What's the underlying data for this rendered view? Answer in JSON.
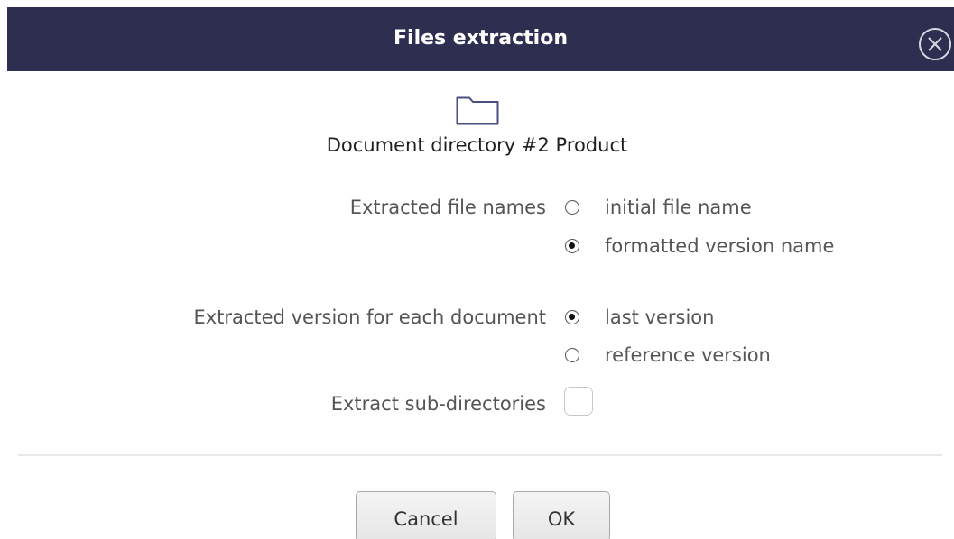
{
  "dialog": {
    "title": "Files extraction",
    "close_icon": "circle-x-icon",
    "folder_icon": "folder-icon",
    "directory_label": "Document directory #2 Product"
  },
  "file_names": {
    "label": "Extracted file names",
    "options": [
      {
        "label": "initial file name",
        "checked": false
      },
      {
        "label": "formatted version name",
        "checked": true
      }
    ]
  },
  "version": {
    "label": "Extracted version for each document",
    "options": [
      {
        "label": "last version",
        "checked": true
      },
      {
        "label": "reference version",
        "checked": false
      }
    ]
  },
  "subdirectories": {
    "label": "Extract sub-directories",
    "checked": false
  },
  "buttons": {
    "cancel_label": "Cancel",
    "ok_label": "OK"
  },
  "colors": {
    "titlebar": "#2e2f50",
    "icon_accent": "#4a4d80"
  }
}
